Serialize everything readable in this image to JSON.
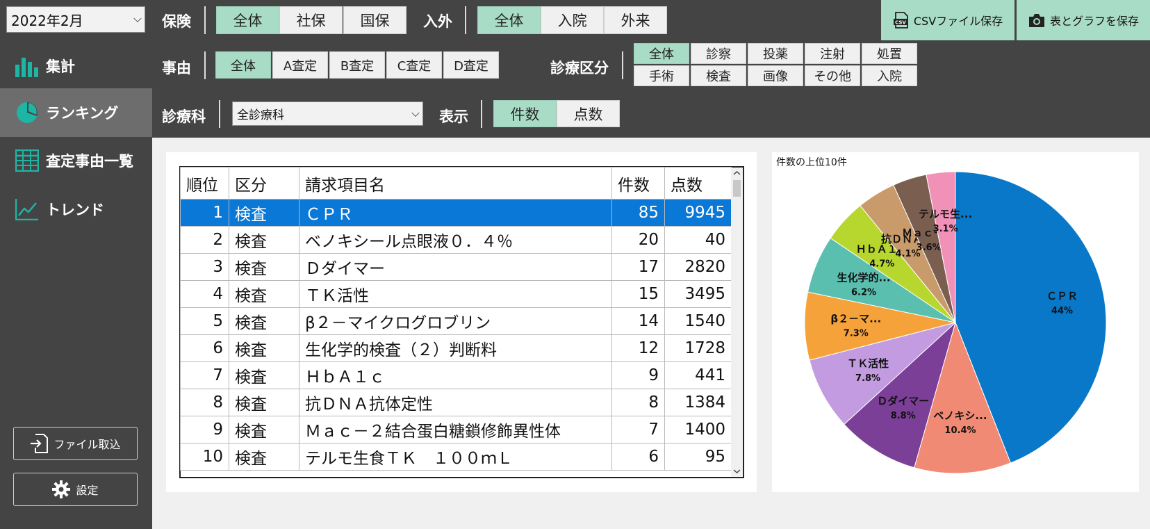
{
  "period": "2022年2月",
  "filters": {
    "insurance": {
      "label": "保険",
      "options": [
        "全体",
        "社保",
        "国保"
      ],
      "selected": 0
    },
    "inout": {
      "label": "入外",
      "options": [
        "全体",
        "入院",
        "外来"
      ],
      "selected": 0
    },
    "reason": {
      "label": "事由",
      "options": [
        "全体",
        "A査定",
        "B査定",
        "C査定",
        "D査定"
      ],
      "selected": 0
    },
    "category": {
      "label": "診療区分",
      "options": [
        "全体",
        "診察",
        "投薬",
        "注射",
        "処置",
        "手術",
        "検査",
        "画像",
        "その他",
        "入院"
      ],
      "selected": 0
    },
    "dept": {
      "label": "診療科",
      "value": "全診療科"
    },
    "display": {
      "label": "表示",
      "options": [
        "件数",
        "点数"
      ],
      "selected": 0
    }
  },
  "actions": {
    "csv": "CSVファイル保存",
    "csv_icon_text": "CSV",
    "save": "表とグラフを保存"
  },
  "nav": [
    {
      "label": "集計",
      "icon": "bar-chart-icon"
    },
    {
      "label": "ランキング",
      "icon": "pie-chart-icon",
      "active": true
    },
    {
      "label": "査定事由一覧",
      "icon": "table-icon"
    },
    {
      "label": "トレンド",
      "icon": "line-chart-icon"
    }
  ],
  "sidebar_buttons": {
    "import": "ファイル取込",
    "settings": "設定"
  },
  "table": {
    "headers": [
      "順位",
      "区分",
      "請求項目名",
      "件数",
      "点数"
    ],
    "rows": [
      {
        "rank": "1",
        "cat": "検査",
        "name": "ＣＰＲ",
        "count": "85",
        "points": "9945"
      },
      {
        "rank": "2",
        "cat": "検査",
        "name": "ベノキシール点眼液０．４％",
        "count": "20",
        "points": "40"
      },
      {
        "rank": "3",
        "cat": "検査",
        "name": "Ｄダイマー",
        "count": "17",
        "points": "2820"
      },
      {
        "rank": "4",
        "cat": "検査",
        "name": "ＴＫ活性",
        "count": "15",
        "points": "3495"
      },
      {
        "rank": "5",
        "cat": "検査",
        "name": "β２－マイクログロブリン",
        "count": "14",
        "points": "1540"
      },
      {
        "rank": "6",
        "cat": "検査",
        "name": "生化学的検査（２）判断料",
        "count": "12",
        "points": "1728"
      },
      {
        "rank": "7",
        "cat": "検査",
        "name": "ＨｂＡ１ｃ",
        "count": "9",
        "points": "441"
      },
      {
        "rank": "8",
        "cat": "検査",
        "name": "抗ＤＮＡ抗体定性",
        "count": "8",
        "points": "1384"
      },
      {
        "rank": "9",
        "cat": "検査",
        "name": "Ｍａｃ－２結合蛋白糖鎖修飾異性体",
        "count": "7",
        "points": "1400"
      },
      {
        "rank": "10",
        "cat": "検査",
        "name": "テルモ生食ＴＫ　１００ｍＬ",
        "count": "6",
        "points": "95"
      }
    ]
  },
  "chart_data": {
    "type": "pie",
    "title": "件数の上位10件",
    "slices": [
      {
        "label": "ＣＰＲ",
        "value": 85,
        "pct": "44%",
        "color": "#0a78c8"
      },
      {
        "label": "ベノキシ...",
        "value": 20,
        "pct": "10.4%",
        "color": "#f08a74"
      },
      {
        "label": "Ｄダイマー",
        "value": 17,
        "pct": "8.8%",
        "color": "#7b3f98"
      },
      {
        "label": "ＴＫ活性",
        "value": 15,
        "pct": "7.8%",
        "color": "#c29be0"
      },
      {
        "label": "β２－マ...",
        "value": 14,
        "pct": "7.3%",
        "color": "#f5a23a"
      },
      {
        "label": "生化学的...",
        "value": 12,
        "pct": "6.2%",
        "color": "#5bbfb0"
      },
      {
        "label": "ＨｂＡ１ｃ",
        "value": 9,
        "pct": "4.7%",
        "color": "#b7d62e"
      },
      {
        "label": "抗ＤＮＡ...",
        "value": 8,
        "pct": "4.1%",
        "color": "#c99a6a"
      },
      {
        "label": "Ｍａｃ－...",
        "value": 7,
        "pct": "3.6%",
        "color": "#7a5e50"
      },
      {
        "label": "テルモ生...",
        "value": 6,
        "pct": "3.1%",
        "color": "#f291b8"
      }
    ]
  }
}
